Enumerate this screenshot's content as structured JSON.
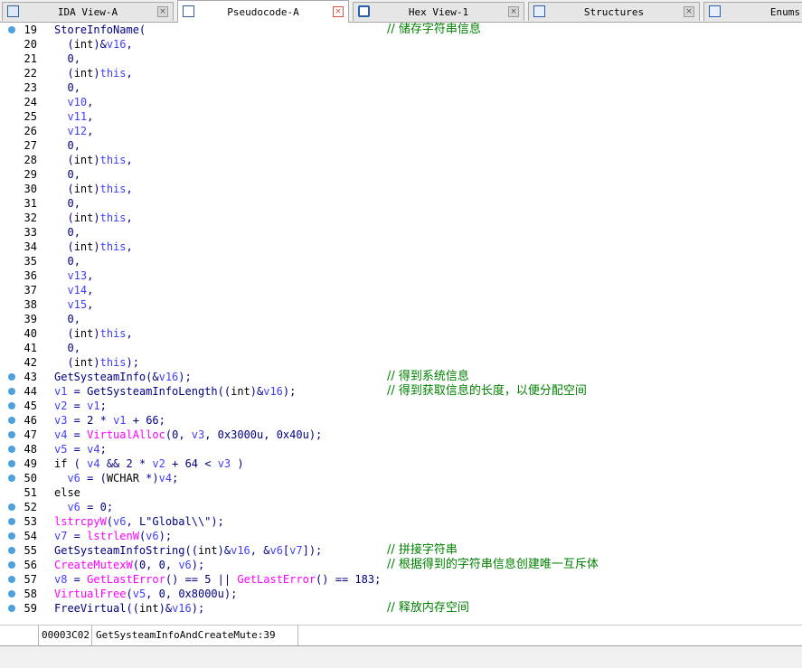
{
  "tabs": [
    {
      "label": "IDA View-A",
      "icon": "ida-view-icon",
      "active": false
    },
    {
      "label": "Pseudocode-A",
      "icon": "pseudocode-icon",
      "active": true
    },
    {
      "label": "Hex View-1",
      "icon": "hex-view-icon",
      "active": false
    },
    {
      "label": "Structures",
      "icon": "structures-icon",
      "active": false
    },
    {
      "label": "Enums",
      "icon": "enums-icon",
      "active": false
    }
  ],
  "tab_close_glyph": "×",
  "colors": {
    "keyword": "#000000",
    "identifier": "#000080",
    "func": "#ff00ff",
    "var": "#4040ff",
    "comment": "#008000",
    "dot": "#4aa3df"
  },
  "lines": [
    {
      "num": "19",
      "dot": true,
      "code": "StoreInfoName(",
      "comment": "// 储存字符串信息"
    },
    {
      "num": "20",
      "dot": false,
      "code": "  (int)&v16,",
      "comment": ""
    },
    {
      "num": "21",
      "dot": false,
      "code": "  0,",
      "comment": ""
    },
    {
      "num": "22",
      "dot": false,
      "code": "  (int)this,",
      "comment": ""
    },
    {
      "num": "23",
      "dot": false,
      "code": "  0,",
      "comment": ""
    },
    {
      "num": "24",
      "dot": false,
      "code": "  v10,",
      "comment": ""
    },
    {
      "num": "25",
      "dot": false,
      "code": "  v11,",
      "comment": ""
    },
    {
      "num": "26",
      "dot": false,
      "code": "  v12,",
      "comment": ""
    },
    {
      "num": "27",
      "dot": false,
      "code": "  0,",
      "comment": ""
    },
    {
      "num": "28",
      "dot": false,
      "code": "  (int)this,",
      "comment": ""
    },
    {
      "num": "29",
      "dot": false,
      "code": "  0,",
      "comment": ""
    },
    {
      "num": "30",
      "dot": false,
      "code": "  (int)this,",
      "comment": ""
    },
    {
      "num": "31",
      "dot": false,
      "code": "  0,",
      "comment": ""
    },
    {
      "num": "32",
      "dot": false,
      "code": "  (int)this,",
      "comment": ""
    },
    {
      "num": "33",
      "dot": false,
      "code": "  0,",
      "comment": ""
    },
    {
      "num": "34",
      "dot": false,
      "code": "  (int)this,",
      "comment": ""
    },
    {
      "num": "35",
      "dot": false,
      "code": "  0,",
      "comment": ""
    },
    {
      "num": "36",
      "dot": false,
      "code": "  v13,",
      "comment": ""
    },
    {
      "num": "37",
      "dot": false,
      "code": "  v14,",
      "comment": ""
    },
    {
      "num": "38",
      "dot": false,
      "code": "  v15,",
      "comment": ""
    },
    {
      "num": "39",
      "dot": false,
      "code": "  0,",
      "comment": ""
    },
    {
      "num": "40",
      "dot": false,
      "code": "  (int)this,",
      "comment": ""
    },
    {
      "num": "41",
      "dot": false,
      "code": "  0,",
      "comment": ""
    },
    {
      "num": "42",
      "dot": false,
      "code": "  (int)this);",
      "comment": ""
    },
    {
      "num": "43",
      "dot": true,
      "code": "GetSysteamInfo(&v16);",
      "comment": "// 得到系统信息"
    },
    {
      "num": "44",
      "dot": true,
      "code": "v1 = GetSysteamInfoLength((int)&v16);",
      "comment": "// 得到获取信息的长度，以便分配空间"
    },
    {
      "num": "45",
      "dot": true,
      "code": "v2 = v1;",
      "comment": ""
    },
    {
      "num": "46",
      "dot": true,
      "code": "v3 = 2 * v1 + 66;",
      "comment": ""
    },
    {
      "num": "47",
      "dot": true,
      "code": "v4 = VirtualAlloc(0, v3, 0x3000u, 0x40u);",
      "comment": ""
    },
    {
      "num": "48",
      "dot": true,
      "code": "v5 = v4;",
      "comment": ""
    },
    {
      "num": "49",
      "dot": true,
      "code": "if ( v4 && 2 * v2 + 64 < v3 )",
      "comment": ""
    },
    {
      "num": "50",
      "dot": true,
      "code": "  v6 = (WCHAR *)v4;",
      "comment": ""
    },
    {
      "num": "51",
      "dot": false,
      "code": "else",
      "comment": ""
    },
    {
      "num": "52",
      "dot": true,
      "code": "  v6 = 0;",
      "comment": ""
    },
    {
      "num": "53",
      "dot": true,
      "code": "lstrcpyW(v6, L\"Global\\\\\");",
      "comment": ""
    },
    {
      "num": "54",
      "dot": true,
      "code": "v7 = lstrlenW(v6);",
      "comment": ""
    },
    {
      "num": "55",
      "dot": true,
      "code": "GetSysteamInfoString((int)&v16, &v6[v7]);",
      "comment": "// 拼接字符串"
    },
    {
      "num": "56",
      "dot": true,
      "code": "CreateMutexW(0, 0, v6);",
      "comment": "// 根据得到的字符串信息创建唯一互斥体"
    },
    {
      "num": "57",
      "dot": true,
      "code": "v8 = GetLastError() == 5 || GetLastError() == 183;",
      "comment": ""
    },
    {
      "num": "58",
      "dot": true,
      "code": "VirtualFree(v5, 0, 0x8000u);",
      "comment": ""
    },
    {
      "num": "59",
      "dot": true,
      "code": "FreeVirtual((int)&v16);",
      "comment": "// 释放内存空间"
    }
  ],
  "status": {
    "address": "00003C02",
    "location": "GetSysteamInfoAndCreateMute:39"
  }
}
